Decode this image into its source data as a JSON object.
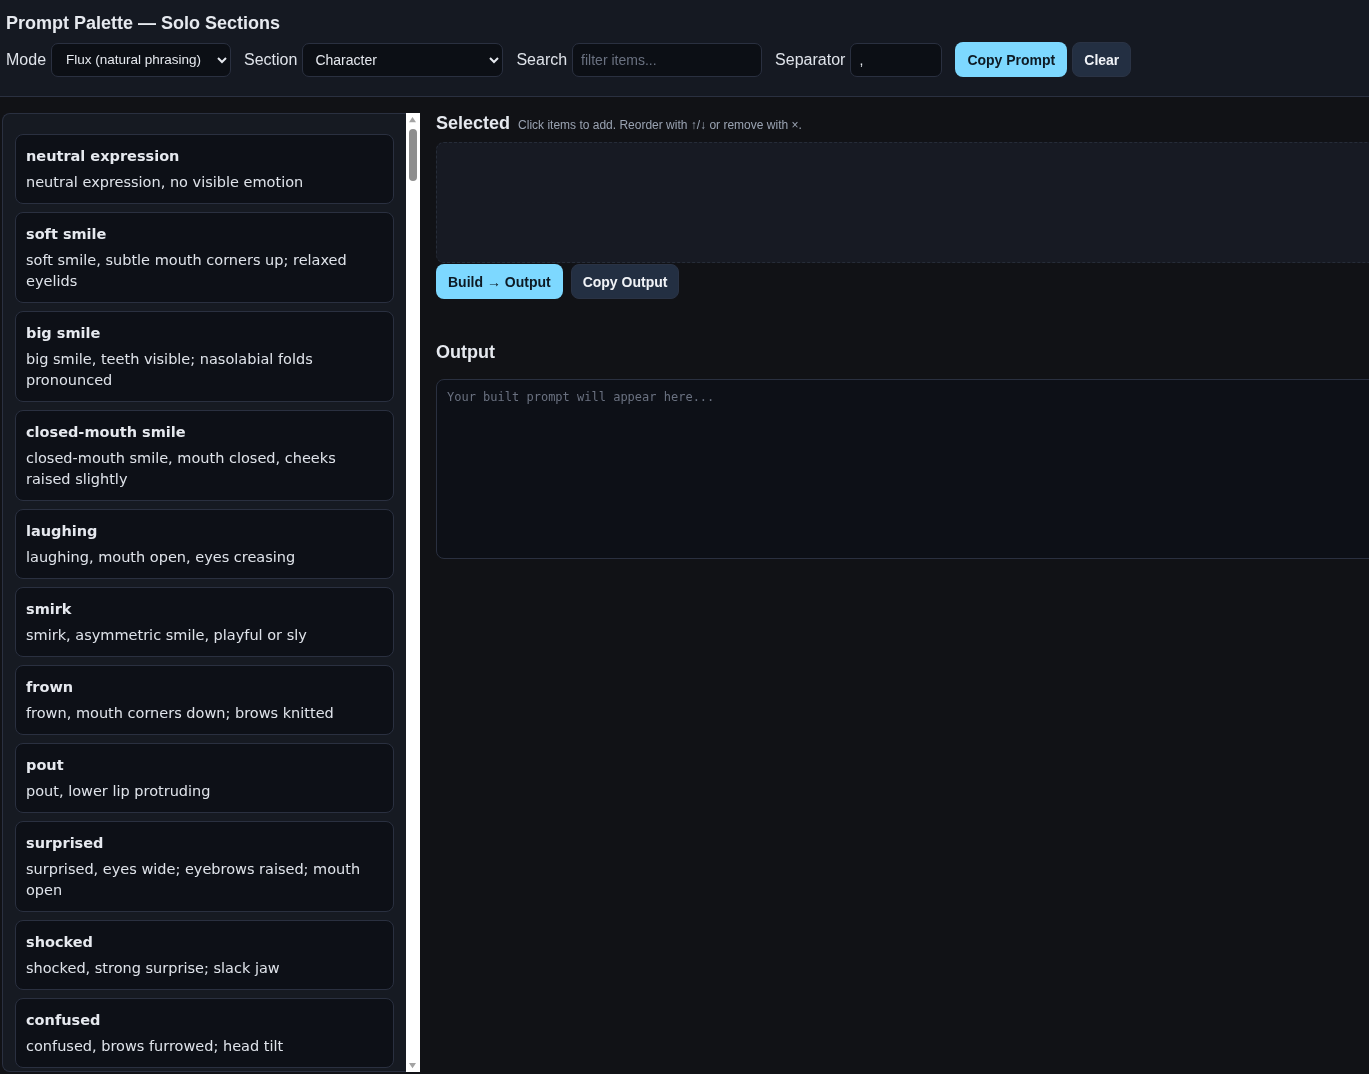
{
  "title": "Prompt Palette — Solo Sections",
  "toolbar": {
    "mode": {
      "label": "Mode",
      "value": "Flux (natural phrasing)"
    },
    "section": {
      "label": "Section",
      "value": "Character"
    },
    "search": {
      "label": "Search",
      "placeholder": "filter items..."
    },
    "separator": {
      "label": "Separator",
      "value": ","
    },
    "buttons": [
      {
        "label": "Copy Prompt",
        "kind": "primary"
      },
      {
        "label": "Clear",
        "kind": "secondary"
      }
    ]
  },
  "items": [
    {
      "title": "neutral expression",
      "text": "neutral expression, no visible emotion"
    },
    {
      "title": "soft smile",
      "text": "soft smile, subtle mouth corners up; relaxed eyelids"
    },
    {
      "title": "big smile",
      "text": "big smile, teeth visible; nasolabial folds pronounced"
    },
    {
      "title": "closed-mouth smile",
      "text": "closed-mouth smile, mouth closed, cheeks raised slightly"
    },
    {
      "title": "laughing",
      "text": "laughing, mouth open, eyes creasing"
    },
    {
      "title": "smirk",
      "text": "smirk, asymmetric smile, playful or sly"
    },
    {
      "title": "frown",
      "text": "frown, mouth corners down; brows knitted"
    },
    {
      "title": "pout",
      "text": "pout, lower lip protruding"
    },
    {
      "title": "surprised",
      "text": "surprised, eyes wide; eyebrows raised; mouth open"
    },
    {
      "title": "shocked",
      "text": "shocked, strong surprise; slack jaw"
    },
    {
      "title": "confused",
      "text": "confused, brows furrowed; head tilt"
    }
  ],
  "selected": {
    "title": "Selected",
    "hint": "Click items to add. Reorder with ↑/↓ or remove with ×.",
    "buttons": [
      {
        "label": "Build → Output",
        "kind": "primary"
      },
      {
        "label": "Copy Output",
        "kind": "secondary"
      }
    ]
  },
  "output": {
    "title": "Output",
    "placeholder": "Your built prompt will appear here..."
  }
}
